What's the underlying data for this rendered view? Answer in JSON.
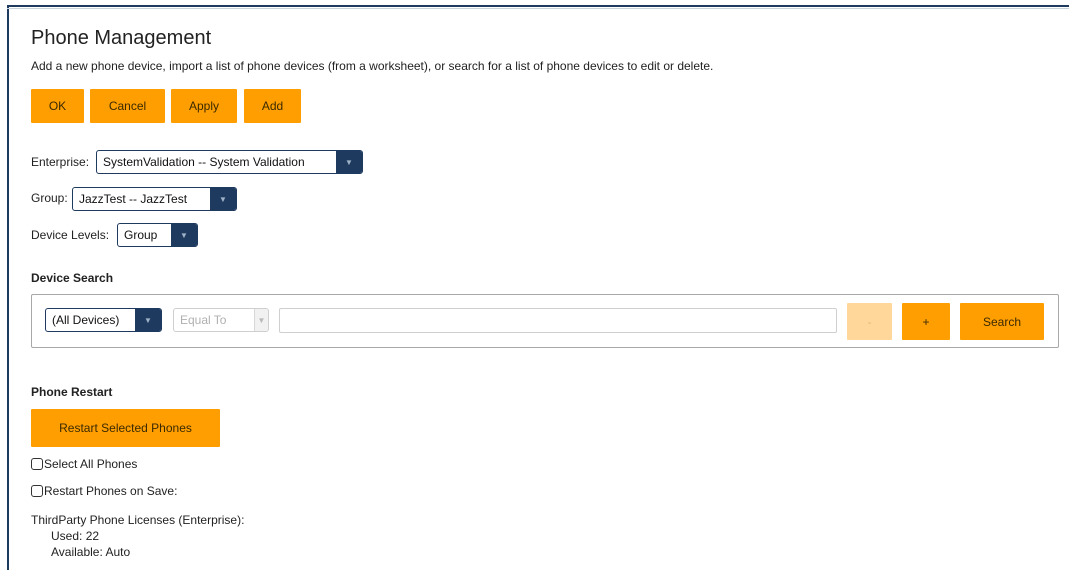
{
  "page": {
    "title": "Phone Management",
    "description": "Add a new phone device, import a list of phone devices (from a worksheet), or search for a list of phone devices to edit or delete."
  },
  "actions": {
    "ok_label": "OK",
    "cancel_label": "Cancel",
    "apply_label": "Apply",
    "add_label": "Add"
  },
  "filters": {
    "enterprise_label": "Enterprise:",
    "enterprise_value": "SystemValidation -- System Validation",
    "group_label": "Group:",
    "group_value": "JazzTest -- JazzTest",
    "device_levels_label": "Device Levels:",
    "device_levels_value": "Group"
  },
  "device_search": {
    "title": "Device Search",
    "device_type_value": "(All Devices)",
    "operator_value": "Equal To",
    "search_text_value": "",
    "remove_label": "-",
    "add_label": "+",
    "search_label": "Search"
  },
  "phone_restart": {
    "title": "Phone Restart",
    "restart_button_label": "Restart Selected Phones",
    "select_all_label": "Select All Phones",
    "restart_on_save_label": "Restart Phones on Save:"
  },
  "licenses": {
    "title": "ThirdParty Phone Licenses (Enterprise):",
    "used_label": "Used:",
    "used_value": "22",
    "available_label": "Available:",
    "available_value": "Auto"
  },
  "colors": {
    "accent": "#ff9e00",
    "accent_disabled": "#ffd79a",
    "navy": "#1e3a5f"
  },
  "icons": {
    "dropdown": "chevron-down-icon"
  }
}
